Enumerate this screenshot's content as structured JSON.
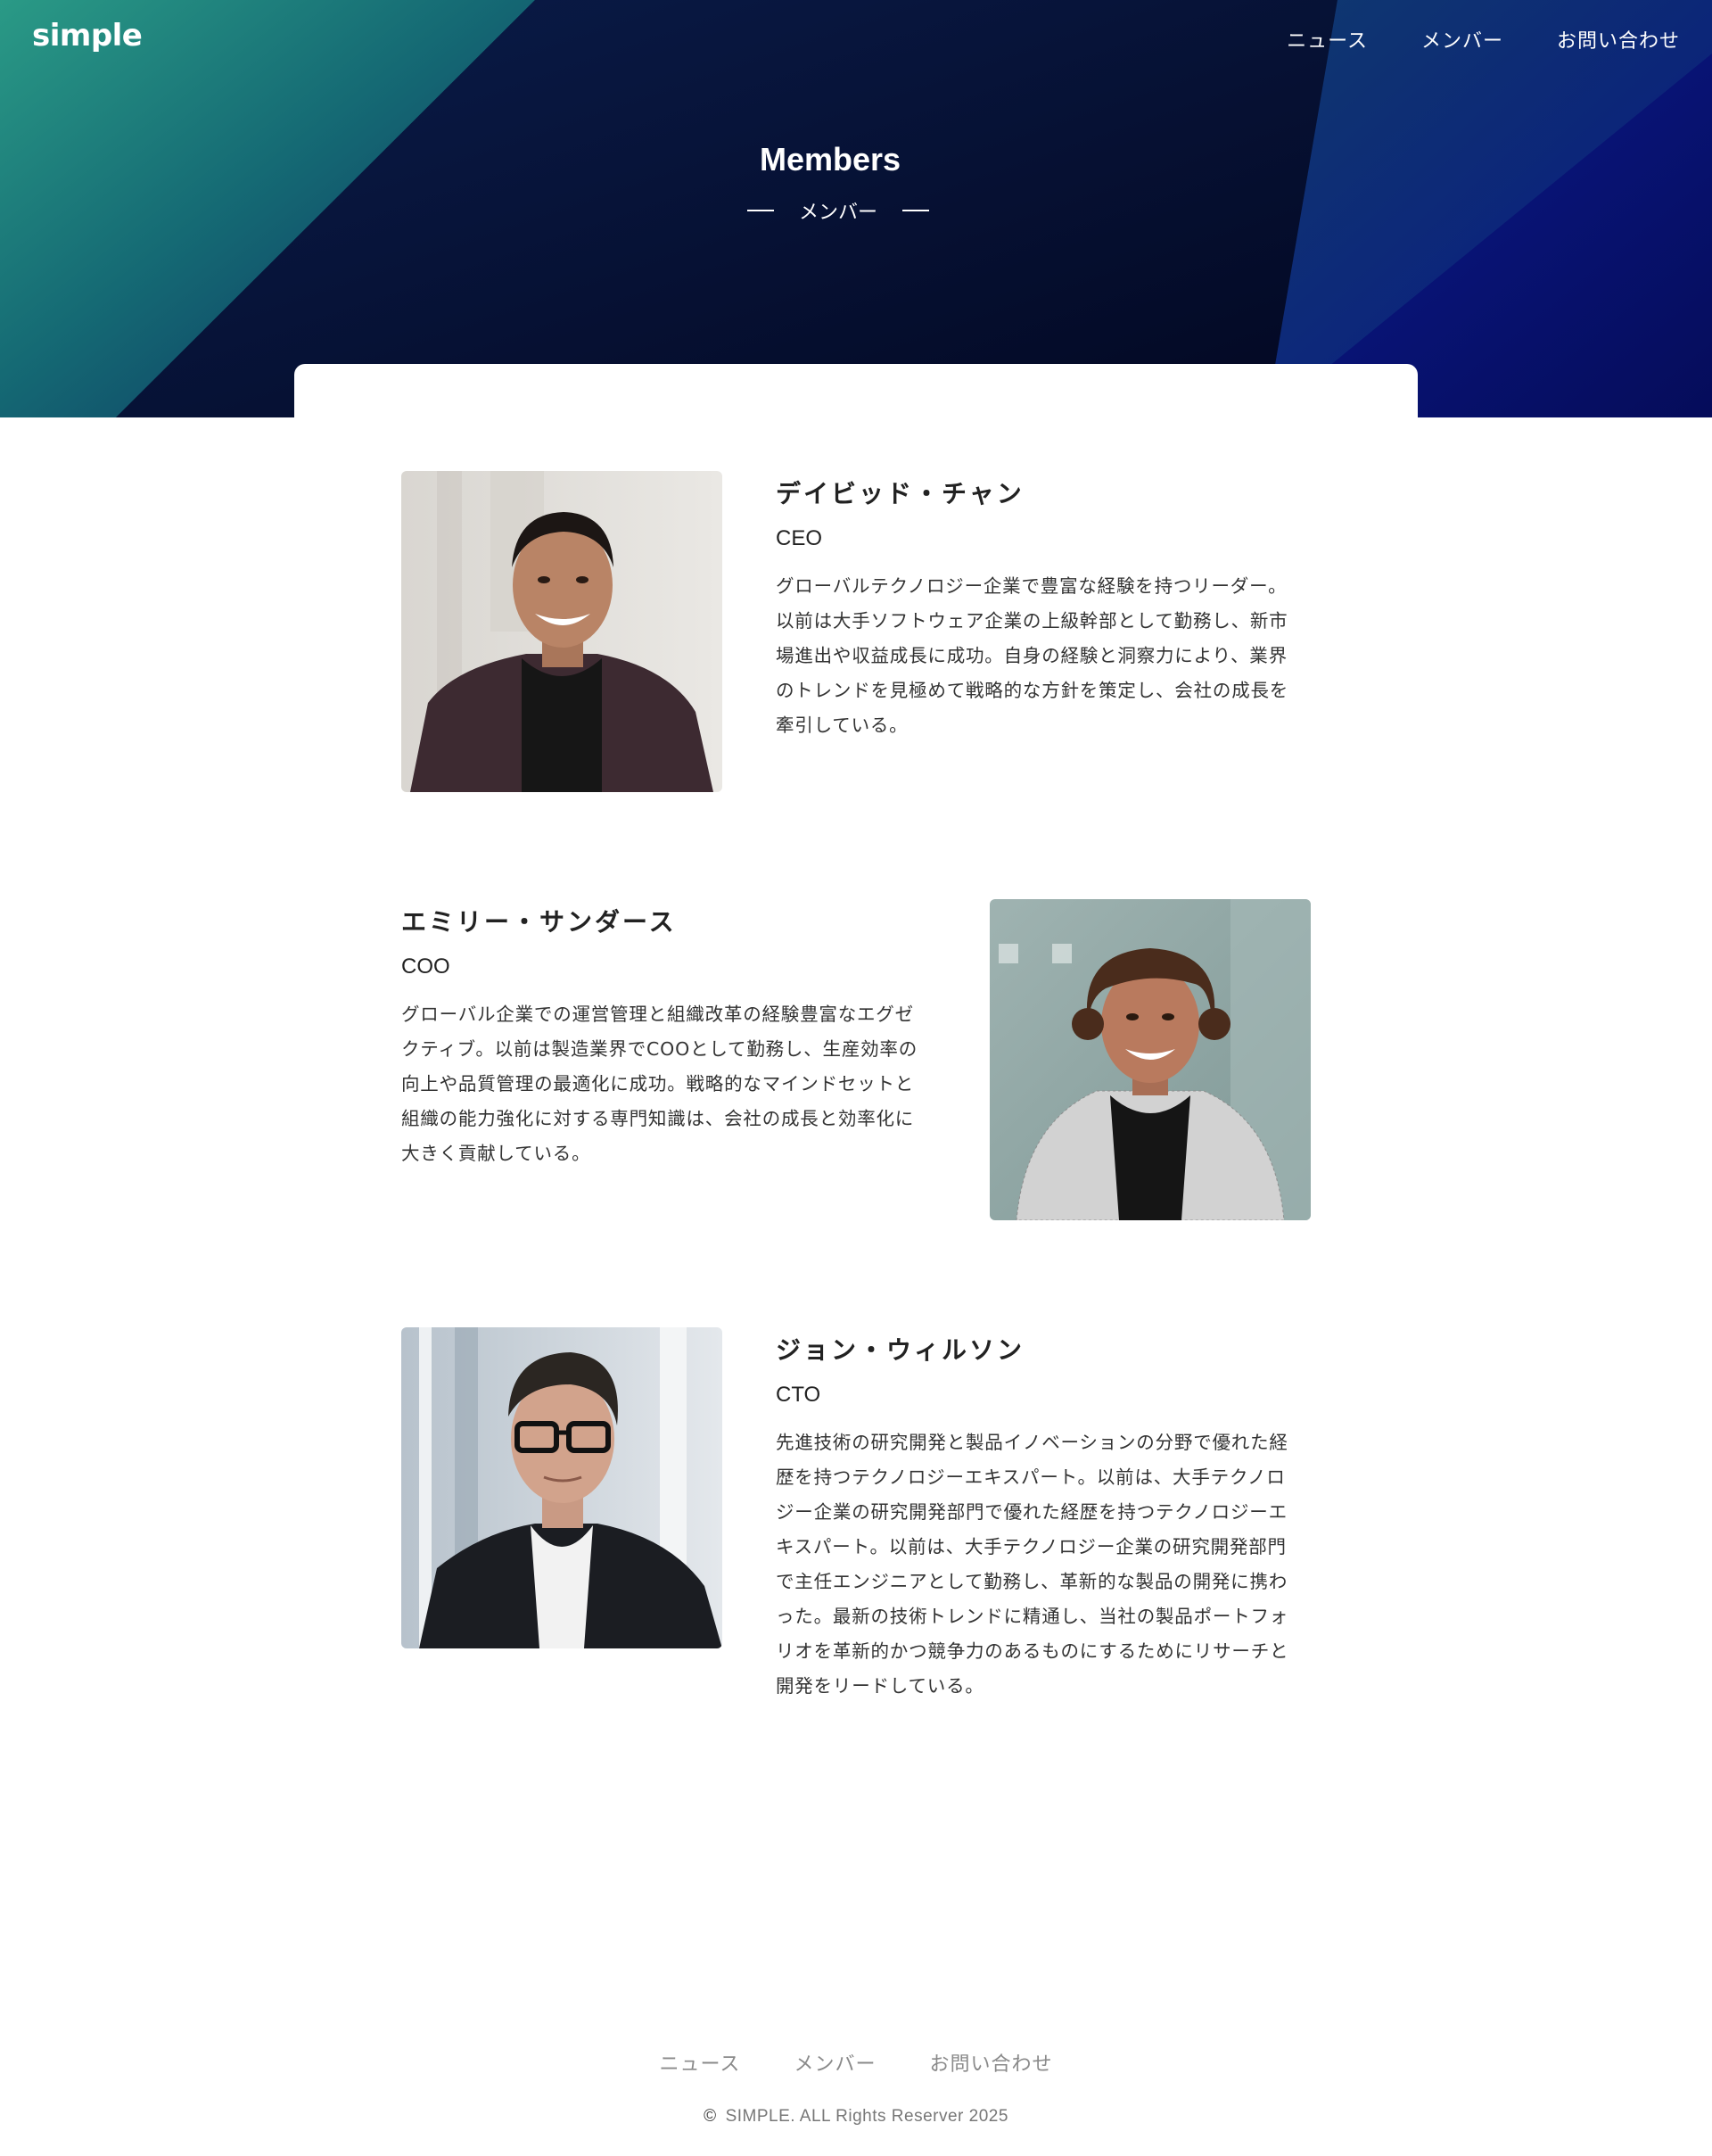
{
  "header": {
    "logo": "simple",
    "nav": [
      "ニュース",
      "メンバー",
      "お問い合わせ"
    ]
  },
  "hero": {
    "title": "Members",
    "subtitle": "メンバー"
  },
  "members": [
    {
      "name": "デイビッド・チャン",
      "role": "CEO",
      "bio": "グローバルテクノロジー企業で豊富な経験を持つリーダー。\n以前は大手ソフトウェア企業の上級幹部として勤務し、新市\n場進出や収益成長に成功。自身の経験と洞察力により、業界\nのトレンドを見極めて戦略的な方針を策定し、会社の成長を\n牽引している。"
    },
    {
      "name": "エミリー・サンダース",
      "role": "COO",
      "bio": "グローバル企業での運営管理と組織改革の経験豊富なエグゼ\nクティブ。以前は製造業界でCOOとして勤務し、生産効率の\n向上や品質管理の最適化に成功。戦略的なマインドセットと\n組織の能力強化に対する専門知識は、会社の成長と効率化に\n大きく貢献している。"
    },
    {
      "name": "ジョン・ウィルソン",
      "role": "CTO",
      "bio": "先進技術の研究開発と製品イノベーションの分野で優れた経\n歴を持つテクノロジーエキスパート。以前は、大手テクノロ\nジー企業の研究開発部門で優れた経歴を持つテクノロジーエ\nキスパート。以前は、大手テクノロジー企業の研究開発部門\nで主任エンジニアとして勤務し、革新的な製品の開発に携わ\nった。最新の技術トレンドに精通し、当社の製品ポートフォ\nリオを革新的かつ競争力のあるものにするためにリサーチと\n開発をリードしている。"
    }
  ],
  "footer": {
    "nav": [
      "ニュース",
      "メンバー",
      "お問い合わせ"
    ],
    "copyright_symbol": "©",
    "copyright": "SIMPLE. ALL Rights Reserver 2025"
  },
  "colors": {
    "hero_dark": "#050d33",
    "hero_teal": "#1f8f7a",
    "hero_blue": "#0b1f8f",
    "footer_text": "#8a8a8a"
  }
}
